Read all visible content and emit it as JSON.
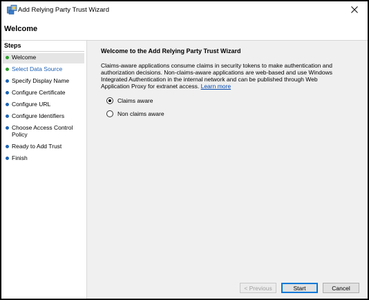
{
  "window": {
    "title": "Add Relying Party Trust Wizard"
  },
  "header": {
    "title": "Welcome"
  },
  "sidebar": {
    "heading": "Steps",
    "items": [
      {
        "label": "Welcome",
        "status": "done"
      },
      {
        "label": "Select Data Source",
        "status": "done"
      },
      {
        "label": "Specify Display Name",
        "status": "pending"
      },
      {
        "label": "Configure Certificate",
        "status": "pending"
      },
      {
        "label": "Configure URL",
        "status": "pending"
      },
      {
        "label": "Configure Identifiers",
        "status": "pending"
      },
      {
        "label": "Choose Access Control Policy",
        "status": "pending"
      },
      {
        "label": "Ready to Add Trust",
        "status": "pending"
      },
      {
        "label": "Finish",
        "status": "pending"
      }
    ]
  },
  "main": {
    "title": "Welcome to the Add Relying Party Trust Wizard",
    "description": "Claims-aware applications consume claims in security tokens to make authentication and authorization decisions. Non-claims-aware applications are web-based and use Windows Integrated Authentication in the internal network and can be published through Web Application Proxy for extranet access.",
    "learn_more": "Learn more",
    "options": [
      {
        "label": "Claims aware",
        "checked": true
      },
      {
        "label": "Non claims aware",
        "checked": false
      }
    ]
  },
  "buttons": {
    "previous": "< Previous",
    "start": "Start",
    "cancel": "Cancel"
  },
  "colors": {
    "done_dot": "#2ca02c",
    "pending_dot": "#1c64b4",
    "link": "#0046ad",
    "content_bg": "#f0f0f0"
  },
  "icons": {
    "app": "adfs-wizard-icon",
    "close": "close-icon"
  }
}
